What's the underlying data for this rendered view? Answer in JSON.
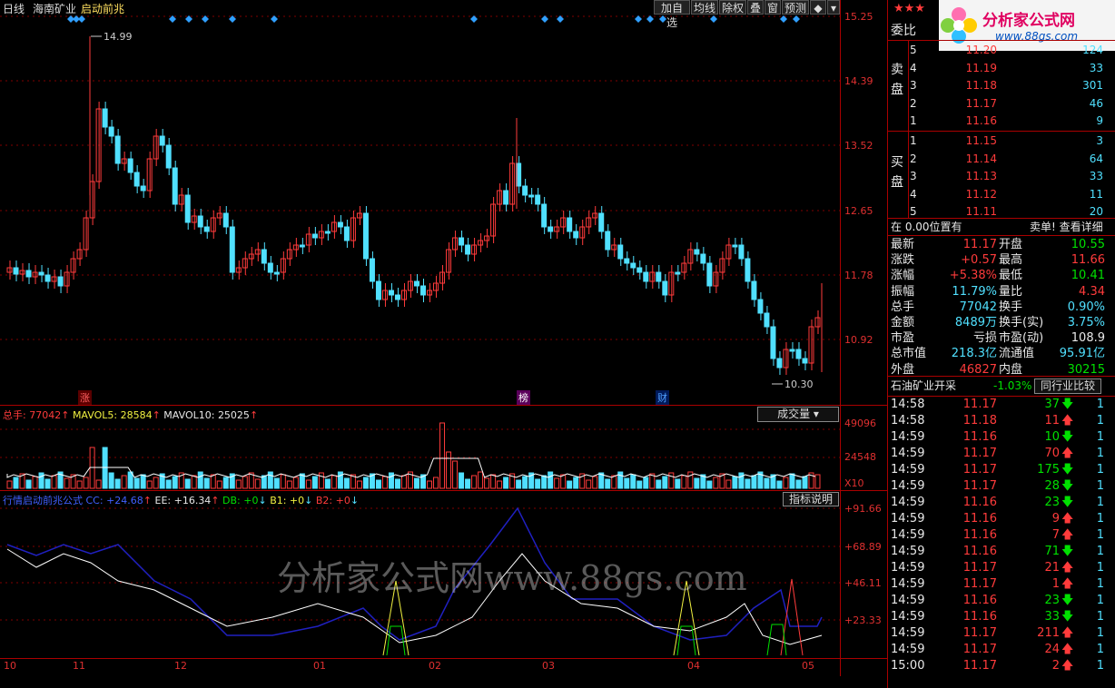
{
  "toolbar": {
    "period": "日线",
    "stock_name": "海南矿业",
    "indicator": "启动前兆",
    "buttons": [
      "加自选",
      "均线",
      "除权",
      "叠",
      "窗",
      "预测"
    ]
  },
  "price_axis": [
    "15.25",
    "14.39",
    "13.52",
    "12.65",
    "11.78",
    "10.92"
  ],
  "price_annotations": {
    "high": "14.99",
    "low": "10.30"
  },
  "event_tags": [
    {
      "label": "涨",
      "color": "#ff3b3b"
    },
    {
      "label": "榜",
      "color": "#ffffff"
    },
    {
      "label": "财",
      "color": "#50a0ff"
    }
  ],
  "volume_legend": {
    "total_label": "总手:",
    "total_value": "77042",
    "mavol5_label": "MAVOL5:",
    "mavol5_value": "28584",
    "mavol10_label": "MAVOL10:",
    "mavol10_value": "25025",
    "selector": "成交量",
    "axis": [
      "49096",
      "24548",
      "X10"
    ]
  },
  "indicator_legend": {
    "name": "行情启动前兆公式",
    "cc": "CC: +24.68",
    "ee": "EE: +16.34",
    "db": "DB: +0",
    "b1": "B1: +0",
    "b2": "B2: +0",
    "help": "指标说明",
    "axis": [
      "+91.66",
      "+68.89",
      "+46.11",
      "+23.33"
    ]
  },
  "date_axis": [
    "10",
    "11",
    "12",
    "01",
    "02",
    "03",
    "04",
    "05"
  ],
  "watermark": "分析家公式网www.88gs.com",
  "logo": {
    "title": "分析家公式网",
    "url": "www.88gs.com",
    "stars": "★★★"
  },
  "order_book": {
    "header": "委比",
    "sell_label": "卖盘",
    "buy_label": "买盘",
    "sell": [
      {
        "level": "5",
        "price": "11.20",
        "vol": "124"
      },
      {
        "level": "4",
        "price": "11.19",
        "vol": "33"
      },
      {
        "level": "3",
        "price": "11.18",
        "vol": "301"
      },
      {
        "level": "2",
        "price": "11.17",
        "vol": "46"
      },
      {
        "level": "1",
        "price": "11.16",
        "vol": "9"
      }
    ],
    "buy": [
      {
        "level": "1",
        "price": "11.15",
        "vol": "3"
      },
      {
        "level": "2",
        "price": "11.14",
        "vol": "64"
      },
      {
        "level": "3",
        "price": "11.13",
        "vol": "33"
      },
      {
        "level": "4",
        "price": "11.12",
        "vol": "11"
      },
      {
        "level": "5",
        "price": "11.11",
        "vol": "20"
      }
    ]
  },
  "position_bar": {
    "left": "在 0.00位置有",
    "right": "卖单! 查看详细"
  },
  "quote": [
    {
      "l1": "最新",
      "v1": "11.17",
      "c1": "red",
      "l2": "开盘",
      "v2": "10.55",
      "c2": "grn"
    },
    {
      "l1": "涨跌",
      "v1": "+0.57",
      "c1": "red",
      "l2": "最高",
      "v2": "11.66",
      "c2": "red"
    },
    {
      "l1": "涨幅",
      "v1": "+5.38%",
      "c1": "red",
      "l2": "最低",
      "v2": "10.41",
      "c2": "grn"
    },
    {
      "l1": "振幅",
      "v1": "11.79%",
      "c1": "cya",
      "l2": "量比",
      "v2": "4.34",
      "c2": "red"
    },
    {
      "l1": "总手",
      "v1": "77042",
      "c1": "cya",
      "l2": "换手",
      "v2": "0.90%",
      "c2": "cya"
    },
    {
      "l1": "金额",
      "v1": "8489万",
      "c1": "cya",
      "l2": "换手(实)",
      "v2": "3.75%",
      "c2": "cya"
    },
    {
      "l1": "市盈",
      "v1": "亏损",
      "c1": "wht",
      "l2": "市盈(动)",
      "v2": "108.9",
      "c2": "wht"
    },
    {
      "l1": "总市值",
      "v1": "218.3亿",
      "c1": "cya",
      "l2": "流通值",
      "v2": "95.91亿",
      "c2": "cya"
    },
    {
      "l1": "外盘",
      "v1": "46827",
      "c1": "red",
      "l2": "内盘",
      "v2": "30215",
      "c2": "grn"
    }
  ],
  "industry": {
    "name": "石油矿业开采",
    "change": "-1.03%",
    "compare": "同行业比较"
  },
  "ticks": [
    {
      "time": "14:58",
      "price": "11.17",
      "vol": "37",
      "dir": "down",
      "n": "1"
    },
    {
      "time": "14:58",
      "price": "11.18",
      "vol": "11",
      "dir": "up",
      "n": "1"
    },
    {
      "time": "14:59",
      "price": "11.16",
      "vol": "10",
      "dir": "down",
      "n": "1"
    },
    {
      "time": "14:59",
      "price": "11.17",
      "vol": "70",
      "dir": "up",
      "n": "1"
    },
    {
      "time": "14:59",
      "price": "11.17",
      "vol": "175",
      "dir": "down",
      "n": "1"
    },
    {
      "time": "14:59",
      "price": "11.17",
      "vol": "28",
      "dir": "down",
      "n": "1"
    },
    {
      "time": "14:59",
      "price": "11.16",
      "vol": "23",
      "dir": "down",
      "n": "1"
    },
    {
      "time": "14:59",
      "price": "11.16",
      "vol": "9",
      "dir": "up",
      "n": "1"
    },
    {
      "time": "14:59",
      "price": "11.16",
      "vol": "7",
      "dir": "up",
      "n": "1"
    },
    {
      "time": "14:59",
      "price": "11.16",
      "vol": "71",
      "dir": "down",
      "n": "1"
    },
    {
      "time": "14:59",
      "price": "11.17",
      "vol": "21",
      "dir": "up",
      "n": "1"
    },
    {
      "time": "14:59",
      "price": "11.17",
      "vol": "1",
      "dir": "up",
      "n": "1"
    },
    {
      "time": "14:59",
      "price": "11.16",
      "vol": "23",
      "dir": "down",
      "n": "1"
    },
    {
      "time": "14:59",
      "price": "11.16",
      "vol": "33",
      "dir": "down",
      "n": "1"
    },
    {
      "time": "14:59",
      "price": "11.17",
      "vol": "211",
      "dir": "up",
      "n": "1"
    },
    {
      "time": "14:59",
      "price": "11.17",
      "vol": "24",
      "dir": "up",
      "n": "1"
    },
    {
      "time": "15:00",
      "price": "11.17",
      "vol": "2",
      "dir": "up",
      "n": "1"
    }
  ],
  "colors": {
    "up": "#ff3b3b",
    "down": "#50e0ff",
    "grid": "#a00000",
    "ma5": "#ffffff",
    "cc": "#2020c0"
  }
}
